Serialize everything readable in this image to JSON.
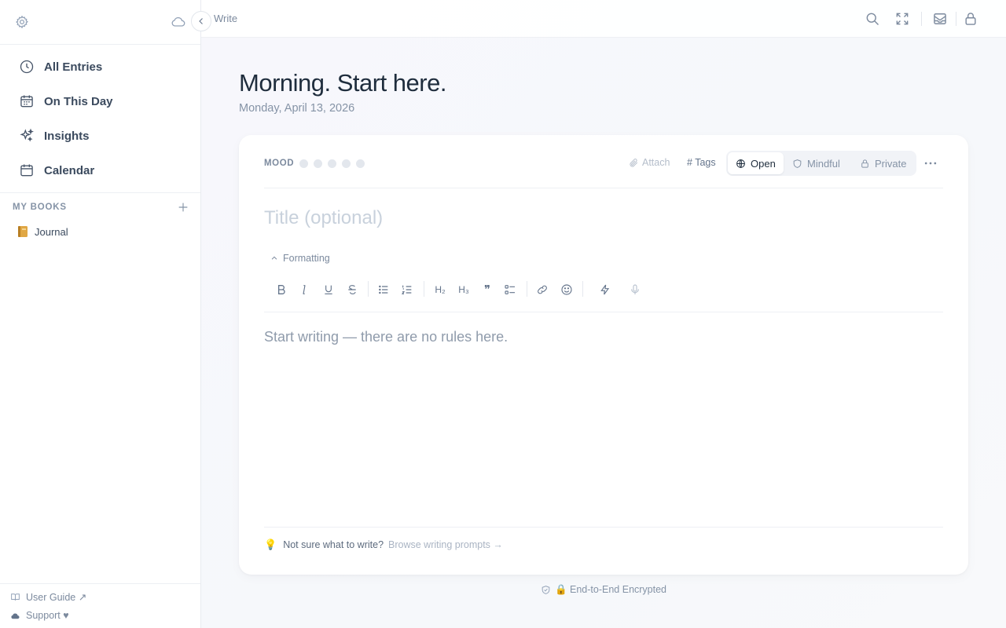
{
  "sidebar": {
    "nav": [
      {
        "label": "All Entries",
        "icon": "clock-icon"
      },
      {
        "label": "On This Day",
        "icon": "calendar-day-icon"
      },
      {
        "label": "Insights",
        "icon": "sparkles-icon"
      },
      {
        "label": "Calendar",
        "icon": "calendar-icon"
      }
    ],
    "books_heading": "MY BOOKS",
    "books": [
      {
        "label": "Journal",
        "icon": "notebook-icon",
        "color": "#d9a441"
      }
    ],
    "bottom": {
      "guide": "User Guide ↗",
      "support": "Support ♥"
    }
  },
  "topbar": {
    "crumb": "Write"
  },
  "page": {
    "title": "Morning. Start here.",
    "date": "Monday, April 13, 2026"
  },
  "editor": {
    "mood_label": "MOOD",
    "mood_count": 5,
    "attach": "Attach",
    "tags": "# Tags",
    "visibility": {
      "open": "Open",
      "mindful": "Mindful",
      "private": "Private",
      "selected": "Open"
    },
    "title_placeholder": "Title (optional)",
    "formatting_label": "Formatting",
    "toolbar": {
      "h2": "H₂",
      "h3": "H₃",
      "quote": "❞"
    },
    "body_placeholder": "Start writing — there are no rules here.",
    "prompt_question": "Not sure what to write?",
    "prompt_link": "Browse writing prompts →",
    "bulb": "💡"
  },
  "footer": {
    "encrypted": "🔒 End-to-End Encrypted"
  },
  "colors": {
    "accent": "#1f2d3d",
    "muted": "#8593a6",
    "border": "#e8ebf0"
  }
}
